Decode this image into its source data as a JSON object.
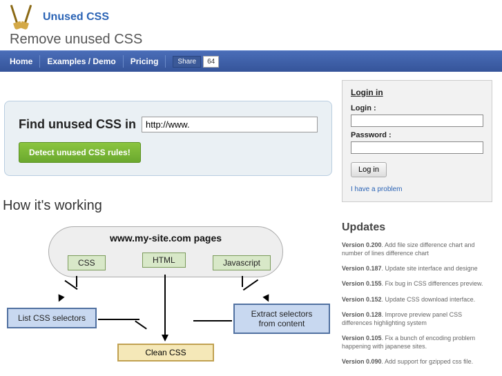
{
  "header": {
    "site_title": "Unused CSS",
    "tagline": "Remove unused CSS"
  },
  "nav": {
    "home": "Home",
    "examples": "Examples / Demo",
    "pricing": "Pricing",
    "fb_share": "Share",
    "fb_count": "64"
  },
  "search": {
    "label": "Find unused CSS in",
    "input_value": "http://www.",
    "button": "Detect unused CSS rules!"
  },
  "how": {
    "heading": "How it's working",
    "cloud_title": "www.my-site.com pages",
    "tag_css": "CSS",
    "tag_html": "HTML",
    "tag_js": "Javascript",
    "box_list": "List CSS selectors",
    "box_extract": "Extract selectors from content",
    "box_clean": "Clean CSS"
  },
  "login": {
    "title": "Login in",
    "login_label": "Login :",
    "password_label": "Password :",
    "button": "Log in",
    "problem": "I have a problem"
  },
  "updates": {
    "title": "Updates",
    "items": [
      {
        "ver": "Version 0.200",
        "text": ". Add file size difference chart and number of lines difference chart"
      },
      {
        "ver": "Version 0.187",
        "text": ". Update site interface and designe"
      },
      {
        "ver": "Version 0.155",
        "text": ". Fix bug in CSS differences preview."
      },
      {
        "ver": "Version 0.152",
        "text": ". Update CSS download interface."
      },
      {
        "ver": "Version 0.128",
        "text": ". Improve preview panel CSS differences highlighting system"
      },
      {
        "ver": "Version 0.105",
        "text": ". Fix a bunch of encoding problem happening with japanese sites."
      },
      {
        "ver": "Version 0.090",
        "text": ". Add support for gzipped css file."
      }
    ]
  }
}
